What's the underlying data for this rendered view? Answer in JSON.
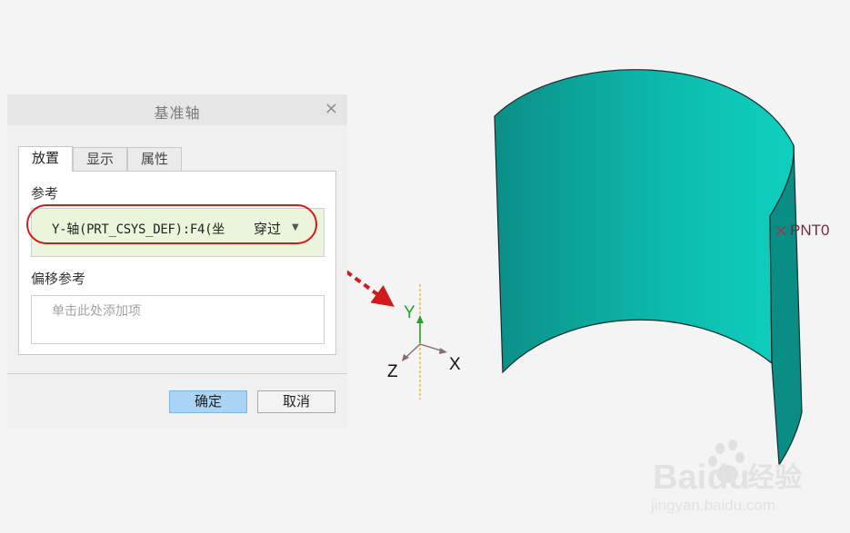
{
  "dialog": {
    "title": "基准轴",
    "close_glyph": "×",
    "tabs": [
      {
        "label": "放置",
        "active": true
      },
      {
        "label": "显示",
        "active": false
      },
      {
        "label": "属性",
        "active": false
      }
    ],
    "reference_label": "参考",
    "reference_item": "Y-轴(PRT_CSYS_DEF):F4(坐",
    "reference_type": "穿过",
    "offset_label": "偏移参考",
    "offset_placeholder": "单击此处添加项",
    "ok_label": "确定",
    "cancel_label": "取消"
  },
  "viewport": {
    "axis_labels": {
      "y": "Y",
      "z": "Z",
      "x": "X"
    },
    "point_marker": "×",
    "point_label": "PNT0"
  },
  "watermark": {
    "brand": "Bai",
    "brand2": "du",
    "product": "经验",
    "url": "jingyan.baidu.com"
  },
  "colors": {
    "surface_dark": "#0b8f88",
    "surface_light": "#0ecdbd",
    "annotation_red": "#d11a1a",
    "ok_button": "#a9d4f5",
    "axis_green": "#27a327",
    "axis_dotted": "#e8b21a"
  },
  "icons": [
    "close-icon",
    "dropdown-caret-icon",
    "coordinate-system-icon",
    "datum-point-icon"
  ]
}
